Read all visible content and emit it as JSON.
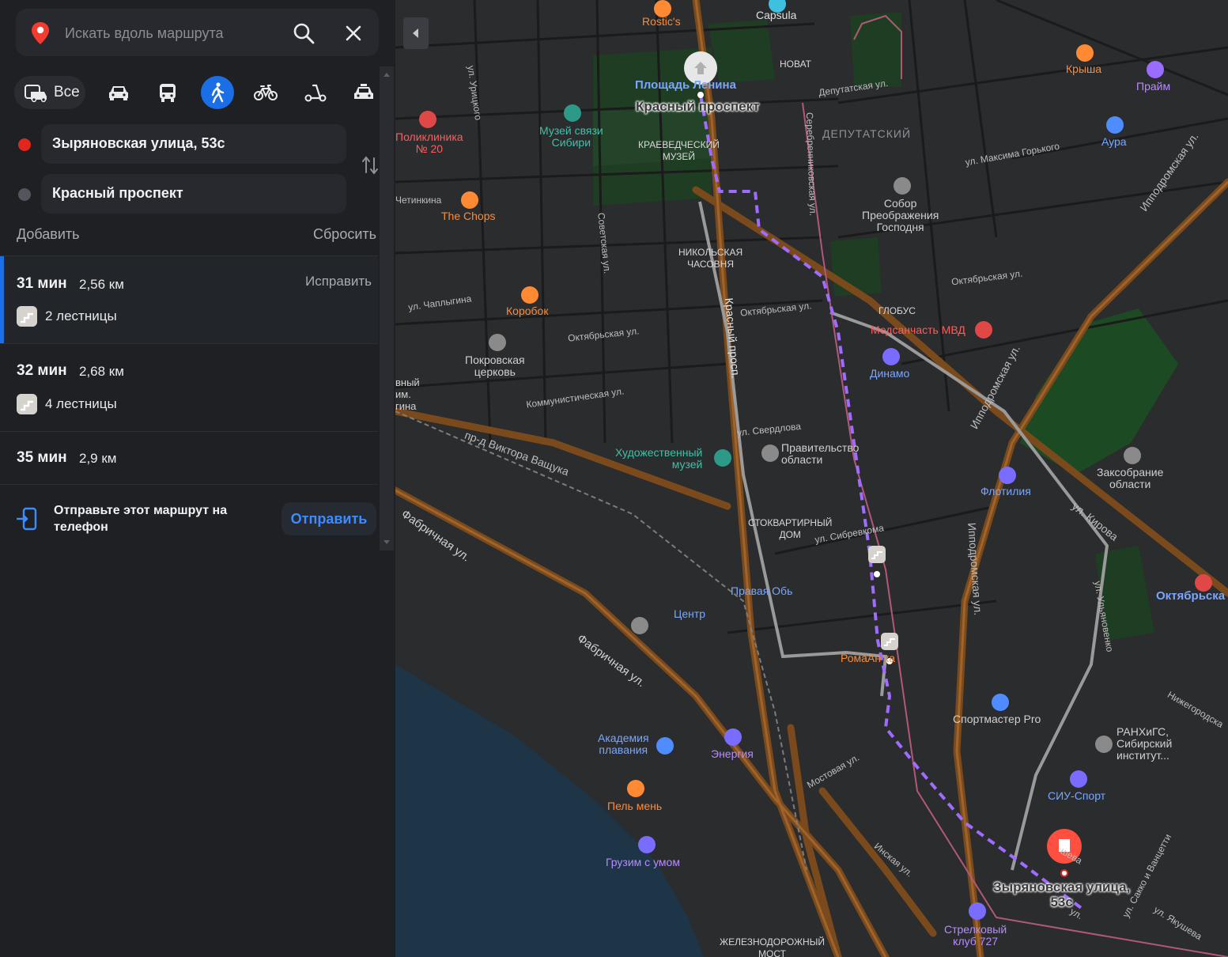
{
  "search": {
    "placeholder": "Искать вдоль маршрута"
  },
  "modes": {
    "all_label": "Все"
  },
  "route": {
    "from": "Зыряновская улица, 53с",
    "to": "Красный проспект",
    "add_label": "Добавить",
    "reset_label": "Сбросить"
  },
  "alternatives": [
    {
      "time": "31 мин",
      "distance": "2,56 км",
      "fix_label": "Исправить",
      "stairs": "2 лестницы"
    },
    {
      "time": "32 мин",
      "distance": "2,68 км",
      "stairs": "4 лестницы"
    },
    {
      "time": "35 мин",
      "distance": "2,9 км"
    }
  ],
  "send": {
    "text": "Отправьте этот маршрут на телефон",
    "button": "Отправить"
  },
  "colors": {
    "accent": "#1a6ee6",
    "route": "#a26bff",
    "start_dot": "#e0261d",
    "end_dot": "#52555b"
  },
  "map": {
    "labels": {
      "rostics": "Rostic's",
      "capsula": "Capsula",
      "novat": "НОВАТ",
      "ploshchad_lenina": "Площадь Ленина",
      "krasny_start": "Красный проспект",
      "krysha": "Крыша",
      "praim": "Прайм",
      "depputatskaya": "Депутатская ул.",
      "urickogo": "ул. Урицкого",
      "poliklinika": "Поликлиника\n№ 20",
      "muzey_svyazi": "Музей связи\nСибири",
      "kraevedchesky": "КРАЕВЕДЧЕСКИЙ\nМУЗЕЙ",
      "serebrennikovskaya": "Серебренниковская ул.",
      "deputatsky": "ДЕПУТАТСКИЙ",
      "m_gorkogo": "ул. Максима Горького",
      "aura": "Аура",
      "ippodromskaya_top": "Ипподромская ул.",
      "chetinkina": "Четинкина",
      "the_chops": "The Chops",
      "sovetskaya": "Советская ул.",
      "nikolskaya": "НИКОЛЬСКАЯ\nЧАСОВНЯ",
      "sobor": "Собор\nПреображения\nГосподня",
      "oktyabrskaya_r": "Октябрьская ул.",
      "chaplygina": "ул. Чаплыгина",
      "korobok": "Коробок",
      "oktyabrskaya_c": "Октябрьская ул.",
      "globus": "ГЛОБУС",
      "medsanchast": "Медсанчасть МВД",
      "krasny_prosp": "Красный просп.",
      "oktyabrskaya_l": "Октябрьская ул.",
      "pokrovskaya": "Покровская\nцерковь",
      "dinamo": "Динамо",
      "kommunisticheskaya": "Коммунистическая ул.",
      "vnyi": "вный\nим.\nгина",
      "ul_sverdlova": "ул. Свердлова",
      "pr_vashchuka": "пр-д Виктора Ващука",
      "khudozhestvenny": "Художественный\nмузей",
      "pravitelstvo": "Правительство\nобласти",
      "ippodromskaya_mid": "Ипподромская ул.",
      "flotiliya": "Флотилия",
      "zaksobranie": "Заксобрание\nобласти",
      "fabrichnaya_top": "Фабричная ул.",
      "stokvartirny": "СТОКВАРТИРНЫЙ\nДОМ",
      "sibrevkoma": "ул. Сибревкома",
      "ul_kirova": "ул. Кирова",
      "ippodromskaya_low": "Ипподромская ул.",
      "pravaya_ob": "Правая Обь",
      "centr": "Центр",
      "oktyabrskaya_metro": "Октябрьска",
      "romanika": "РомаАн   ка",
      "fabrichnaya_low": "Фабричная ул.",
      "ulyanova": "ул. Ульяновенко",
      "nizhegorodskaya": "Нижегородска",
      "sportmaster": "Спортмастер Pro",
      "akademiya": "Академия\nплавания",
      "energiya": "Энергия",
      "ranhigs": "РАНХиГС,\nСибирский\nинститут...",
      "mostovaya": "Мостовая ул.",
      "siu_sport": "СИУ-Спорт",
      "pel_men": "Пель мень",
      "inskaya": "Инская ул.",
      "gruzim": "Грузим с умом",
      "end_label": "Зыряновская улица,\n53с",
      "vanzetti": "ул. Сакко и Ванцетти",
      "strelkovy": "Стрелковый\nклуб 727",
      "zheleznodorozhny": "ЖЕЛЕЗНОДОРОЖНЫЙ\nМОСТ",
      "yakusheva": "ул. Якушева",
      "sheva": "шева",
      "yul": "ул."
    }
  }
}
